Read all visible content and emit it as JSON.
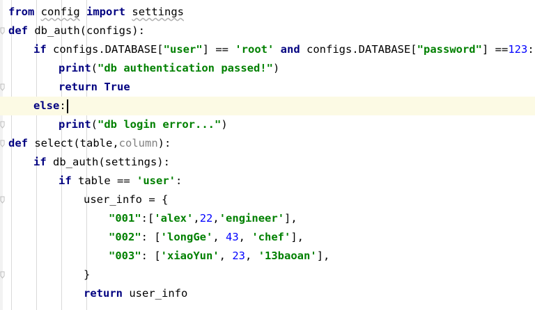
{
  "editor": {
    "current_line_index": 5,
    "lines": [
      {
        "indent": 0,
        "tokens": [
          {
            "t": "from",
            "c": "kw"
          },
          {
            "t": " "
          },
          {
            "t": "config",
            "c": "sq"
          },
          {
            "t": " "
          },
          {
            "t": "import",
            "c": "kw"
          },
          {
            "t": " "
          },
          {
            "t": "settings",
            "c": "sq"
          }
        ]
      },
      {
        "indent": 0,
        "tokens": [
          {
            "t": "def",
            "c": "kw"
          },
          {
            "t": " db_auth(configs):"
          }
        ]
      },
      {
        "indent": 1,
        "tokens": [
          {
            "t": "if",
            "c": "kw"
          },
          {
            "t": " configs.DATABASE["
          },
          {
            "t": "\"user\"",
            "c": "str"
          },
          {
            "t": "] == "
          },
          {
            "t": "'root'",
            "c": "str"
          },
          {
            "t": " "
          },
          {
            "t": "and",
            "c": "kw"
          },
          {
            "t": " configs.DATABASE["
          },
          {
            "t": "\"password\"",
            "c": "str"
          },
          {
            "t": "] =="
          },
          {
            "t": "123",
            "c": "num"
          },
          {
            "t": ":"
          }
        ]
      },
      {
        "indent": 2,
        "tokens": [
          {
            "t": "print",
            "c": "kw"
          },
          {
            "t": "("
          },
          {
            "t": "\"db authentication passed!\"",
            "c": "str"
          },
          {
            "t": ")"
          }
        ]
      },
      {
        "indent": 2,
        "tokens": [
          {
            "t": "return",
            "c": "kw"
          },
          {
            "t": " "
          },
          {
            "t": "True",
            "c": "kw"
          }
        ]
      },
      {
        "indent": 1,
        "tokens": [
          {
            "t": "else",
            "c": "kw"
          },
          {
            "t": ":"
          }
        ]
      },
      {
        "indent": 2,
        "tokens": [
          {
            "t": "print",
            "c": "kw"
          },
          {
            "t": "("
          },
          {
            "t": "\"db login error...\"",
            "c": "str"
          },
          {
            "t": ")"
          }
        ]
      },
      {
        "indent": 0,
        "tokens": [
          {
            "t": "def",
            "c": "kw"
          },
          {
            "t": " select(table,"
          },
          {
            "t": "column",
            "c": "param"
          },
          {
            "t": "):"
          }
        ]
      },
      {
        "indent": 1,
        "tokens": [
          {
            "t": "if",
            "c": "kw"
          },
          {
            "t": " db_auth(settings):"
          }
        ]
      },
      {
        "indent": 2,
        "tokens": [
          {
            "t": "if",
            "c": "kw"
          },
          {
            "t": " table == "
          },
          {
            "t": "'user'",
            "c": "str"
          },
          {
            "t": ":"
          }
        ]
      },
      {
        "indent": 3,
        "tokens": [
          {
            "t": "user_info = {"
          }
        ]
      },
      {
        "indent": 4,
        "tokens": [
          {
            "t": "\"001\"",
            "c": "str"
          },
          {
            "t": ":["
          },
          {
            "t": "'alex'",
            "c": "str"
          },
          {
            "t": ","
          },
          {
            "t": "22",
            "c": "num"
          },
          {
            "t": ","
          },
          {
            "t": "'engineer'",
            "c": "str"
          },
          {
            "t": "],"
          }
        ]
      },
      {
        "indent": 4,
        "tokens": [
          {
            "t": "\"002\"",
            "c": "str"
          },
          {
            "t": ": ["
          },
          {
            "t": "'longGe'",
            "c": "str"
          },
          {
            "t": ", "
          },
          {
            "t": "43",
            "c": "num"
          },
          {
            "t": ", "
          },
          {
            "t": "'chef'",
            "c": "str"
          },
          {
            "t": "],"
          }
        ]
      },
      {
        "indent": 4,
        "tokens": [
          {
            "t": "\"003\"",
            "c": "str"
          },
          {
            "t": ": ["
          },
          {
            "t": "'xiaoYun'",
            "c": "str"
          },
          {
            "t": ", "
          },
          {
            "t": "23",
            "c": "num"
          },
          {
            "t": ", "
          },
          {
            "t": "'13baoan'",
            "c": "str"
          },
          {
            "t": "],"
          }
        ]
      },
      {
        "indent": 3,
        "tokens": [
          {
            "t": "}"
          }
        ]
      },
      {
        "indent": 3,
        "tokens": [
          {
            "t": "return",
            "c": "kw"
          },
          {
            "t": " user_info"
          }
        ]
      }
    ]
  }
}
